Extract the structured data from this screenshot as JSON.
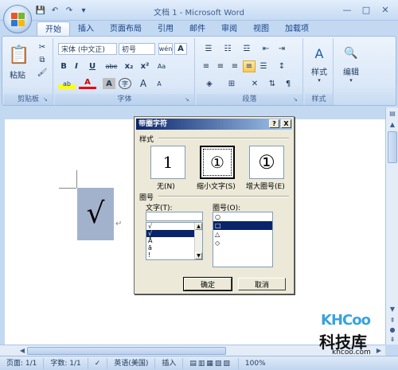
{
  "window": {
    "title": "文档 1 - Microsoft Word",
    "qat_icons": [
      "save-icon",
      "undo-icon",
      "redo-icon",
      "customize-icon"
    ],
    "controls": [
      "minimize-icon",
      "maximize-icon",
      "close-icon"
    ]
  },
  "tabs": [
    {
      "label": "开始",
      "active": true
    },
    {
      "label": "插入"
    },
    {
      "label": "页面布局"
    },
    {
      "label": "引用"
    },
    {
      "label": "邮件"
    },
    {
      "label": "审阅"
    },
    {
      "label": "视图"
    },
    {
      "label": "加载项"
    }
  ],
  "ribbon": {
    "clipboard": {
      "label": "剪贴板",
      "paste": "粘贴"
    },
    "font": {
      "label": "字体",
      "font_name": "宋体 (中文正)",
      "font_size": "初号",
      "wen": "wén",
      "A": "A",
      "bold": "B",
      "italic": "I",
      "underline": "U",
      "strike": "abe",
      "sub": "x₂",
      "sup": "x²",
      "clear": "Aa",
      "highlight": "ab",
      "color": "A",
      "shade": "A",
      "circle": "字",
      "grow": "A",
      "shrink": "A"
    },
    "paragraph": {
      "label": "段落"
    },
    "styles": {
      "label": "样式"
    },
    "editing": {
      "label": "编辑"
    }
  },
  "document": {
    "selected_char": "√",
    "paragraph_mark": "↵"
  },
  "dialog": {
    "title": "带圈字符",
    "help": "?",
    "close": "X",
    "style_section": "样式",
    "styles": [
      {
        "glyph": "1",
        "caption": "无(N)"
      },
      {
        "glyph": "①",
        "caption": "缩小文字(S)",
        "selected": true
      },
      {
        "glyph": "①",
        "caption": "增大圈号(E)"
      }
    ],
    "circle_section": "圈号",
    "text_label": "文字(T):",
    "text_value": "",
    "text_items": [
      "√",
      "√",
      "Ā",
      "ā",
      "!"
    ],
    "text_selected_index": 1,
    "enclosure_label": "圈号(O):",
    "enclosure_items": [
      "○",
      "□",
      "△",
      "◇"
    ],
    "enclosure_selected_index": 1,
    "ok": "确定",
    "cancel": "取消"
  },
  "statusbar": {
    "page": "页面: 1/1",
    "words": "字数: 1/1",
    "language": "英语(美国)",
    "mode": "插入",
    "zoom": "100%"
  },
  "watermark": {
    "logo": "KHCoo",
    "name": "科技库",
    "url": "khcoo.com"
  }
}
